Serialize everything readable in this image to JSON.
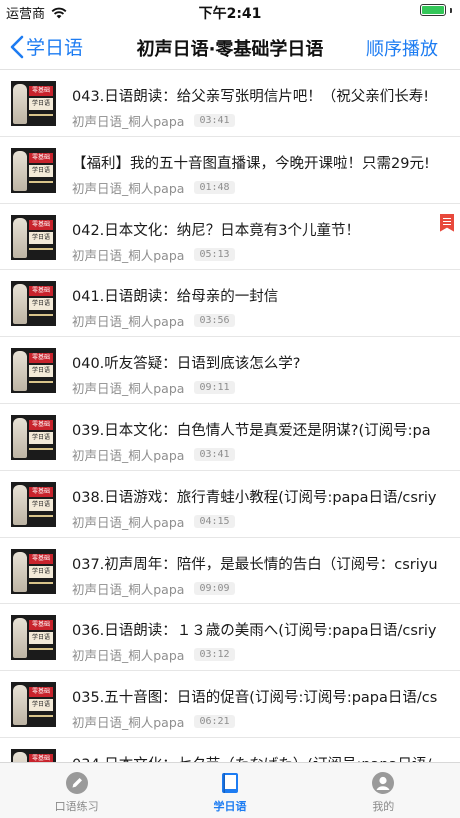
{
  "status": {
    "carrier": "运营商",
    "time": "下午2:41",
    "battery_percent": 100
  },
  "nav": {
    "back_label": "学日语",
    "title": "初声日语·零基础学日语",
    "right_action": "顺序播放"
  },
  "thumbnail": {
    "tag_top": "零基础",
    "tag_bottom": "学日语"
  },
  "episodes": [
    {
      "title": "043.日语朗读：给父亲写张明信片吧！（祝父亲们长寿!",
      "author": "初声日语_桐人papa",
      "duration": "03:41"
    },
    {
      "title": "【福利】我的五十音图直播课，今晚开课啦！只需29元!",
      "author": "初声日语_桐人papa",
      "duration": "01:48"
    },
    {
      "title": "042.日本文化：纳尼？日本竟有3个儿童节！",
      "author": "初声日语_桐人papa",
      "duration": "05:13",
      "bookmarked": true
    },
    {
      "title": "041.日语朗读：给母亲的一封信",
      "author": "初声日语_桐人papa",
      "duration": "03:56"
    },
    {
      "title": "040.听友答疑：日语到底该怎么学?",
      "author": "初声日语_桐人papa",
      "duration": "09:11"
    },
    {
      "title": "039.日本文化：白色情人节是真爱还是阴谋?(订阅号:pa",
      "author": "初声日语_桐人papa",
      "duration": "03:41"
    },
    {
      "title": "038.日语游戏：旅行青蛙小教程(订阅号:papa日语/csriy",
      "author": "初声日语_桐人papa",
      "duration": "04:15"
    },
    {
      "title": "037.初声周年：陪伴，是最长情的告白（订阅号：csriyu",
      "author": "初声日语_桐人papa",
      "duration": "09:09"
    },
    {
      "title": "036.日语朗读：１３歳の美雨へ(订阅号:papa日语/csriy",
      "author": "初声日语_桐人papa",
      "duration": "03:12"
    },
    {
      "title": "035.五十音图：日语的促音(订阅号:订阅号:papa日语/cs",
      "author": "初声日语_桐人papa",
      "duration": "06:21"
    },
    {
      "title": "034.日本文化：七夕节（たなばた）(订阅号:papa日语/",
      "author": "",
      "duration": ""
    }
  ],
  "tabs": [
    {
      "label": "口语练习",
      "icon": "pencil-icon",
      "active": false
    },
    {
      "label": "学日语",
      "icon": "book-icon",
      "active": true
    },
    {
      "label": "我的",
      "icon": "user-icon",
      "active": false
    }
  ],
  "colors": {
    "accent": "#1d7cf2",
    "bookmark": "#e8493c",
    "battery": "#34c759"
  }
}
